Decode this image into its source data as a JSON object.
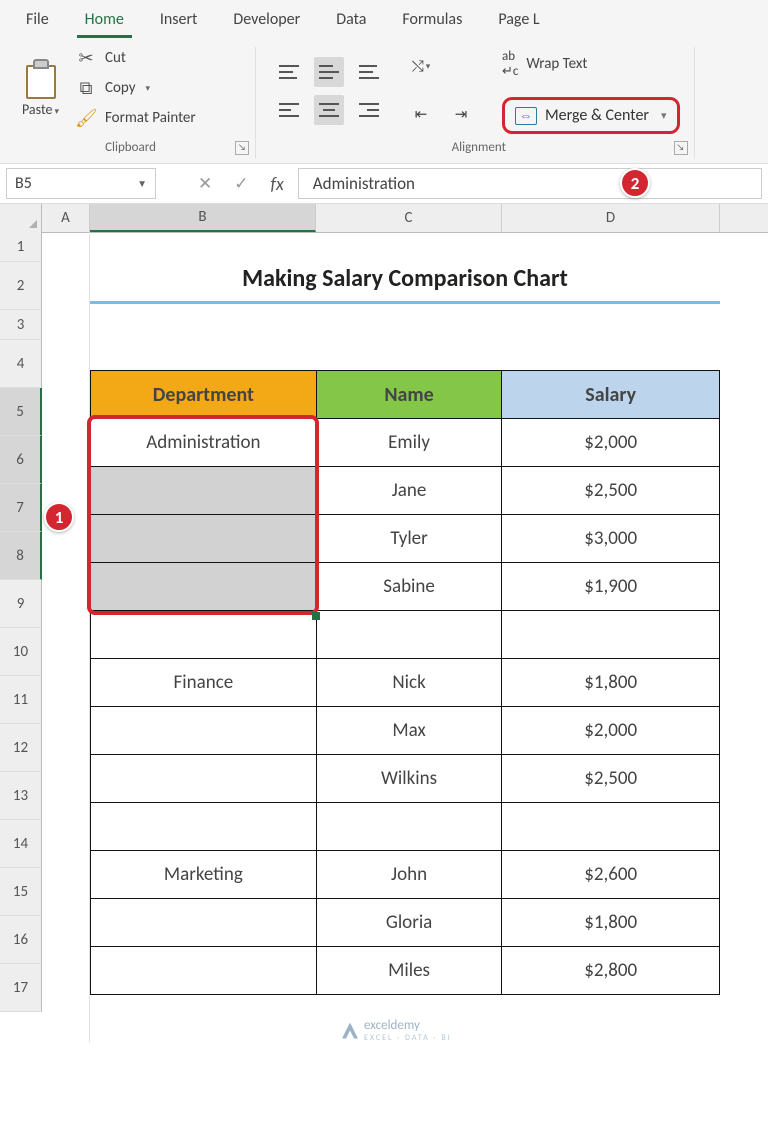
{
  "tabs": [
    "File",
    "Home",
    "Insert",
    "Developer",
    "Data",
    "Formulas",
    "Page L"
  ],
  "active_tab": 1,
  "clipboard": {
    "paste": "Paste",
    "cut": "Cut",
    "copy": "Copy",
    "format_painter": "Format Painter",
    "group": "Clipboard"
  },
  "alignment": {
    "group": "Alignment",
    "wrap": "Wrap Text",
    "merge": "Merge & Center"
  },
  "namebox": "B5",
  "formula_value": "Administration",
  "columns": [
    "A",
    "B",
    "C",
    "D"
  ],
  "rows": [
    "1",
    "2",
    "3",
    "4",
    "5",
    "6",
    "7",
    "8",
    "9",
    "10",
    "11",
    "12",
    "13",
    "14",
    "15",
    "16",
    "17"
  ],
  "title": "Making Salary Comparison Chart",
  "headers": {
    "dept": "Department",
    "name": "Name",
    "salary": "Salary"
  },
  "table": [
    {
      "dept": "Administration",
      "name": "Emily",
      "salary": "$2,000",
      "sel": "first"
    },
    {
      "dept": "",
      "name": "Jane",
      "salary": "$2,500",
      "sel": "y"
    },
    {
      "dept": "",
      "name": "Tyler",
      "salary": "$3,000",
      "sel": "y"
    },
    {
      "dept": "",
      "name": "Sabine",
      "salary": "$1,900",
      "sel": "y"
    },
    {
      "dept": "",
      "name": "",
      "salary": ""
    },
    {
      "dept": "Finance",
      "name": "Nick",
      "salary": "$1,800"
    },
    {
      "dept": "",
      "name": "Max",
      "salary": "$2,000"
    },
    {
      "dept": "",
      "name": "Wilkins",
      "salary": "$2,500"
    },
    {
      "dept": "",
      "name": "",
      "salary": ""
    },
    {
      "dept": "Marketing",
      "name": "John",
      "salary": "$2,600"
    },
    {
      "dept": "",
      "name": "Gloria",
      "salary": "$1,800"
    },
    {
      "dept": "",
      "name": "Miles",
      "salary": "$2,800"
    }
  ],
  "callouts": {
    "1": "1",
    "2": "2"
  },
  "watermark": {
    "brand": "exceldemy",
    "sub": "EXCEL · DATA · BI"
  }
}
